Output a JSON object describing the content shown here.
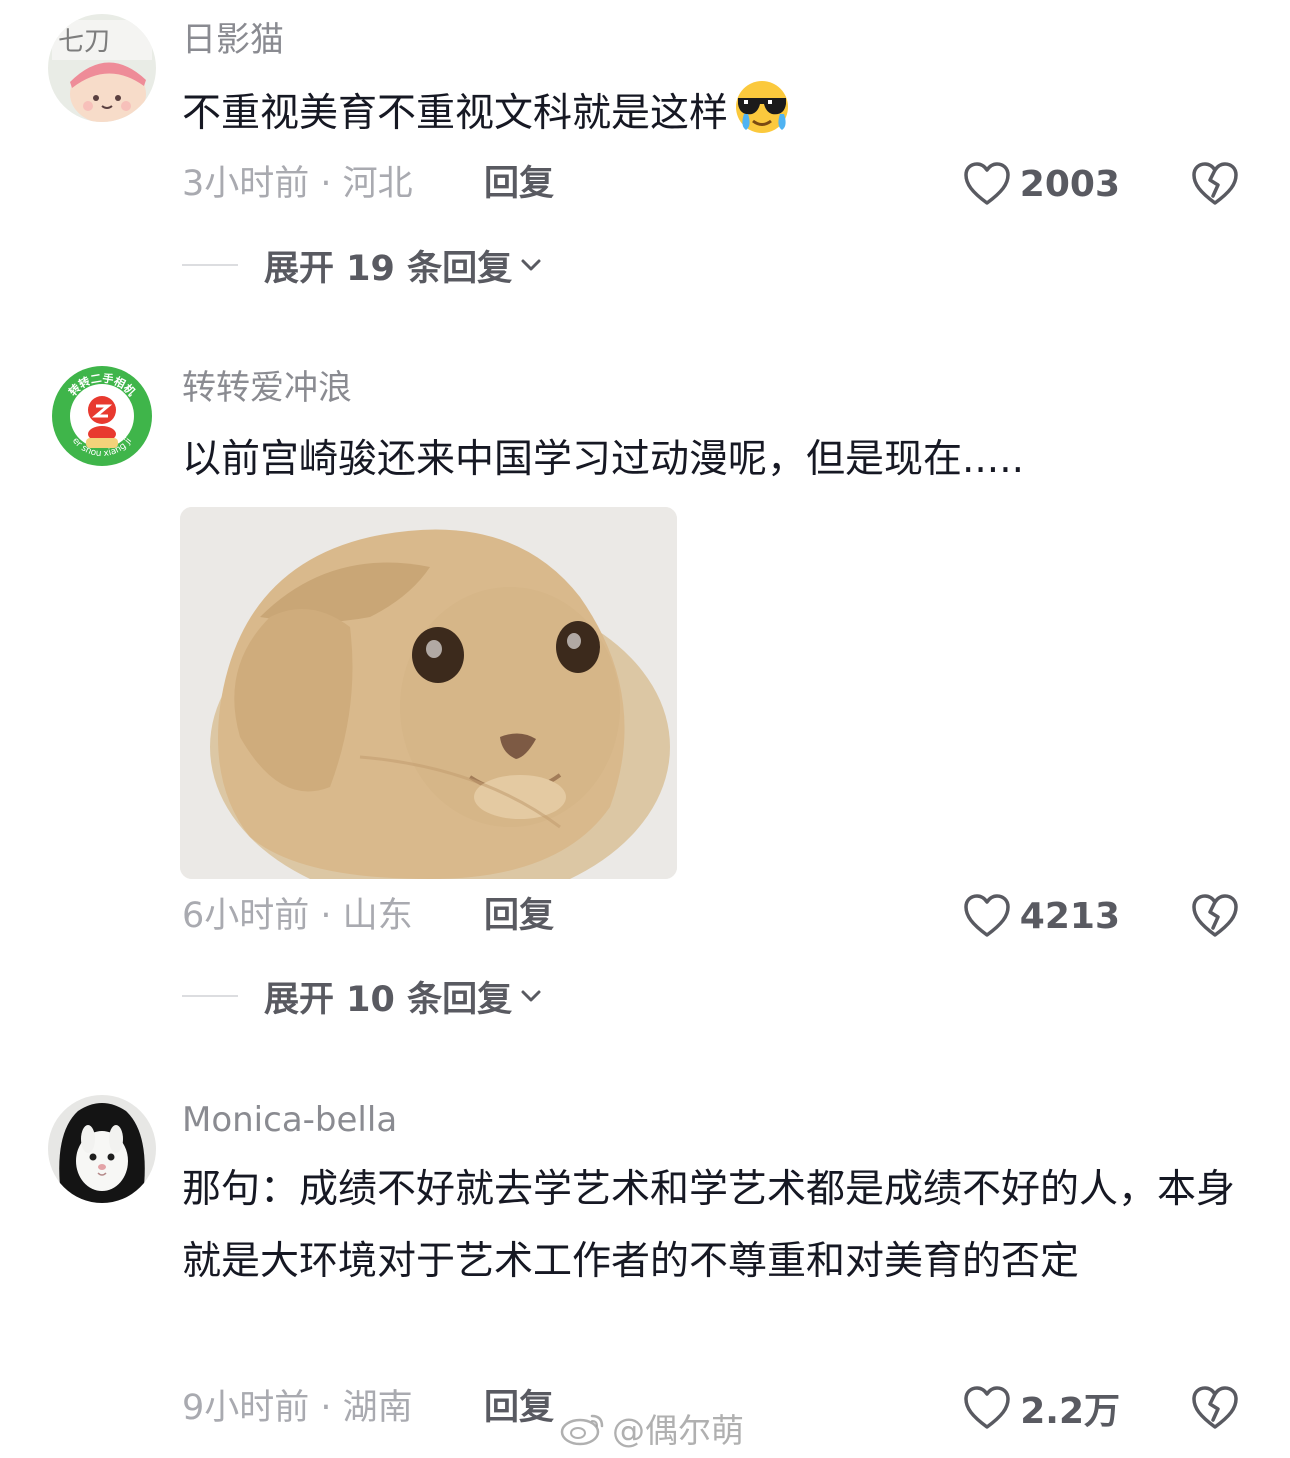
{
  "comments": [
    {
      "username": "日影猫",
      "text": "不重视美育不重视文科就是这样",
      "emoji": "cool-crying-emoji",
      "meta": "3小时前 · 河北",
      "reply_label": "回复",
      "likes": "2003",
      "expand_label": "展开 19 条回复",
      "avatar_text": "七刀"
    },
    {
      "username": "转转爱冲浪",
      "text": "以前宫崎骏还来中国学习过动漫呢，但是现在.....",
      "image": "cat-sticker",
      "meta": "6小时前 · 山东",
      "reply_label": "回复",
      "likes": "4213",
      "expand_label": "展开 10 条回复",
      "avatar_text_top": "转转二手相机",
      "avatar_text_bottom": "er shou xiang ji"
    },
    {
      "username": "Monica-bella",
      "text": "那句：成绩不好就去学艺术和学艺术都是成绩不好的人，本身就是大环境对于艺术工作者的不尊重和对美育的否定",
      "meta": "9小时前 · 湖南",
      "reply_label": "回复",
      "likes": "2.2万"
    }
  ],
  "watermark": {
    "text": "@偶尔萌"
  },
  "icons": {
    "like": "heart-outline-icon",
    "dislike": "broken-heart-icon",
    "expand": "chevron-down-icon"
  },
  "colors": {
    "text_primary": "#161823",
    "text_secondary": "#8a8b91",
    "meta": "#a9aab0",
    "action": "#595a61"
  }
}
